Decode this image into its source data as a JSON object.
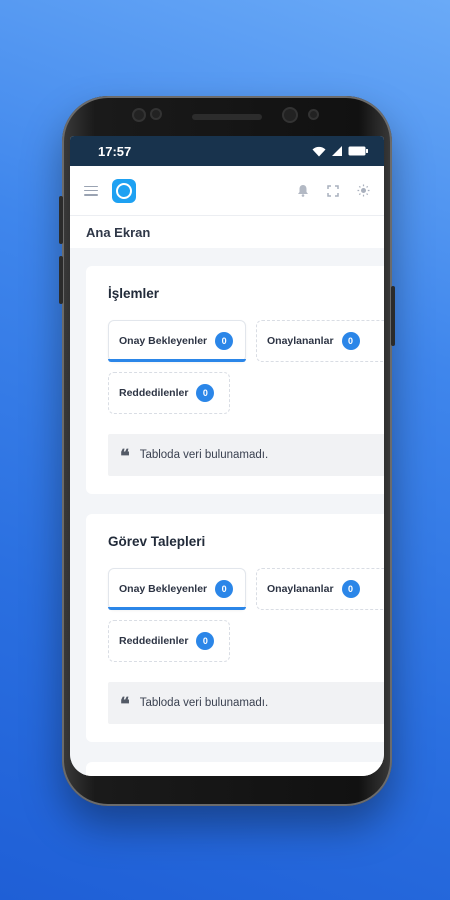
{
  "status_bar": {
    "time": "17:57"
  },
  "app_bar": {
    "menu_icon": "hamburger-icon",
    "logo_icon": "app-logo-icon",
    "bell_icon": "bell-icon",
    "fullscreen_icon": "fullscreen-icon",
    "theme_icon": "sun-icon"
  },
  "page": {
    "title": "Ana Ekran"
  },
  "sections": [
    {
      "title": "İşlemler",
      "tabs": [
        {
          "label": "Onay Bekleyenler",
          "count": "0",
          "active": true
        },
        {
          "label": "Onaylananlar",
          "count": "0",
          "active": false
        },
        {
          "label": "Reddedilenler",
          "count": "0",
          "active": false
        }
      ],
      "empty_message": "Tabloda veri bulunamadı."
    },
    {
      "title": "Görev Talepleri",
      "tabs": [
        {
          "label": "Onay Bekleyenler",
          "count": "0",
          "active": true
        },
        {
          "label": "Onaylananlar",
          "count": "0",
          "active": false
        },
        {
          "label": "Reddedilenler",
          "count": "0",
          "active": false
        }
      ],
      "empty_message": "Tabloda veri bulunamadı."
    }
  ],
  "colors": {
    "accent": "#2b86e8",
    "status_bar_bg": "#18334d",
    "logo": "#1ea1f2"
  }
}
